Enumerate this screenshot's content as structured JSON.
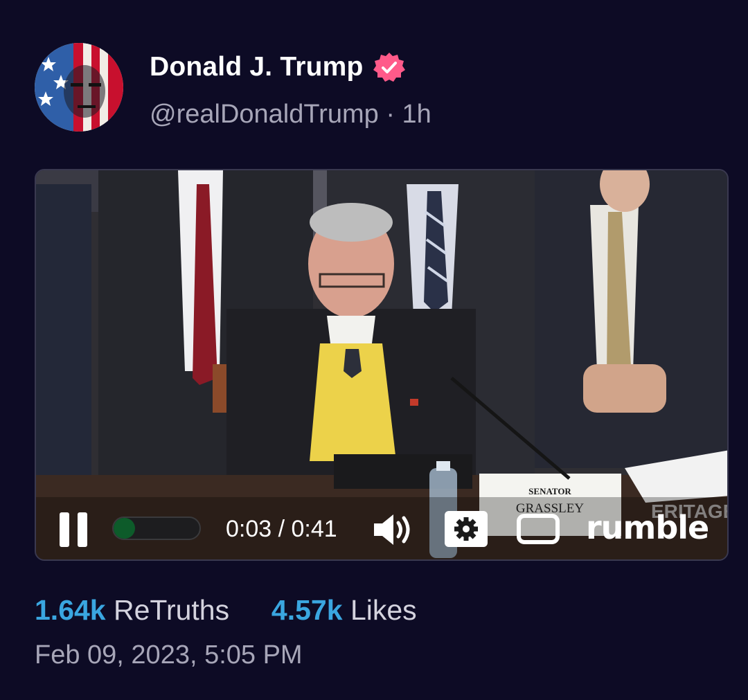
{
  "post": {
    "author_name": "Donald J. Trump",
    "handle": "@realDonaldTrump",
    "separator": "·",
    "age": "1h",
    "avatar_icon": "profile-avatar",
    "verified_icon": "verified-badge-icon",
    "verified_color": "#ff5a8a"
  },
  "video": {
    "nameplate_line1": "SENATOR",
    "nameplate_line2": "GRASSLEY",
    "watermark": "ERITAGE",
    "controls": {
      "current_time": "0:03",
      "duration": "0:41",
      "time_display": "0:03 / 0:41",
      "progress_fraction": 0.073,
      "pause_icon": "pause-icon",
      "volume_icon": "volume-icon",
      "settings_icon": "gear-icon",
      "fullscreen_icon": "fullscreen-icon",
      "brand": "rumble",
      "progress_color": "#0d5b2a"
    }
  },
  "stats": {
    "retruths_count": "1.64k",
    "retruths_label": "ReTruths",
    "likes_count": "4.57k",
    "likes_label": "Likes",
    "count_color": "#3aa6e0"
  },
  "timestamp": "Feb 09, 2023, 5:05 PM"
}
